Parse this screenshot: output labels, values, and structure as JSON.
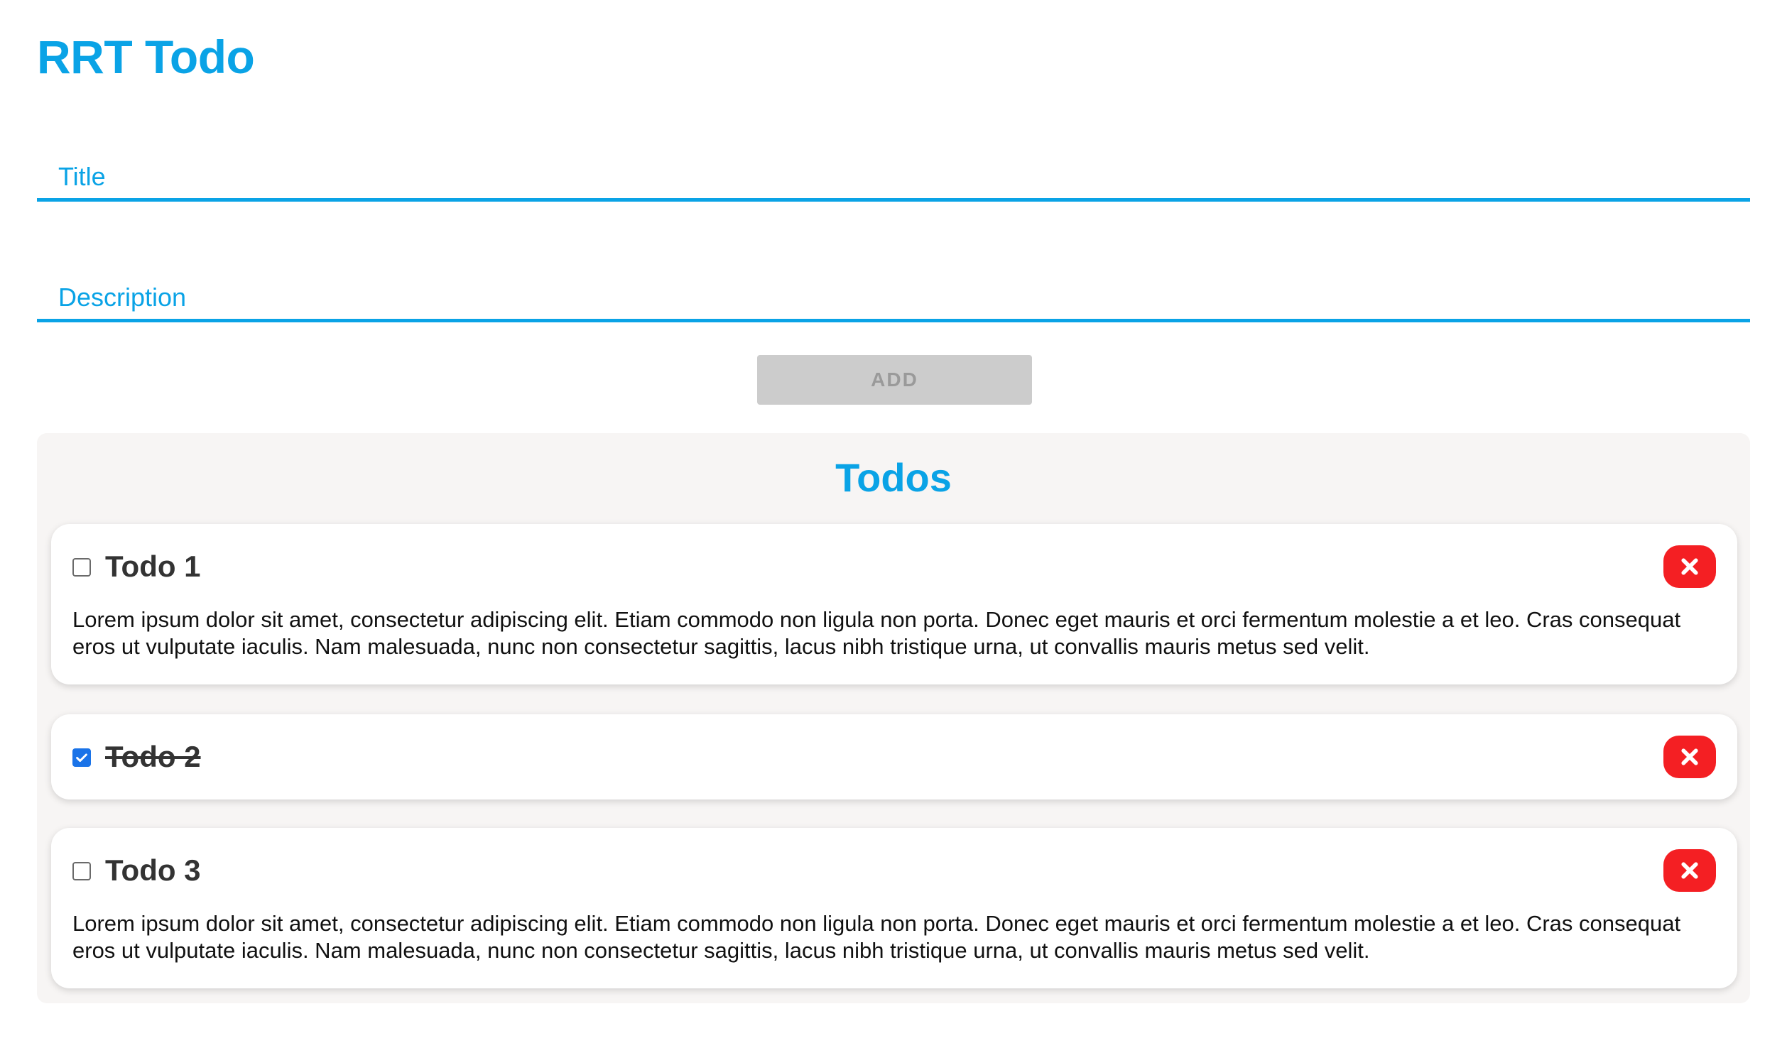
{
  "app": {
    "title": "RRT Todo"
  },
  "form": {
    "title_placeholder": "Title",
    "description_placeholder": "Description",
    "add_label": "ADD"
  },
  "todos_section": {
    "heading": "Todos",
    "items": [
      {
        "title": "Todo 1",
        "completed": false,
        "description": "Lorem ipsum dolor sit amet, consectetur adipiscing elit. Etiam commodo non ligula non porta. Donec eget mauris et orci fermentum molestie a et leo. Cras consequat eros ut vulputate iaculis. Nam malesuada, nunc non consectetur sagittis, lacus nibh tristique urna, ut convallis mauris metus sed velit."
      },
      {
        "title": "Todo 2",
        "completed": true,
        "description": ""
      },
      {
        "title": "Todo 3",
        "completed": false,
        "description": "Lorem ipsum dolor sit amet, consectetur adipiscing elit. Etiam commodo non ligula non porta. Donec eget mauris et orci fermentum molestie a et leo. Cras consequat eros ut vulputate iaculis. Nam malesuada, nunc non consectetur sagittis, lacus nibh tristique urna, ut convallis mauris metus sed velit."
      }
    ]
  },
  "icons": {
    "delete": "close-icon",
    "check": "checkmark-icon"
  },
  "colors": {
    "accent": "#0aa3e6",
    "delete": "#f41f23",
    "checkbox_checked": "#1a73e8",
    "panel_background": "#f7f5f4",
    "button_disabled": "#cccccc"
  }
}
